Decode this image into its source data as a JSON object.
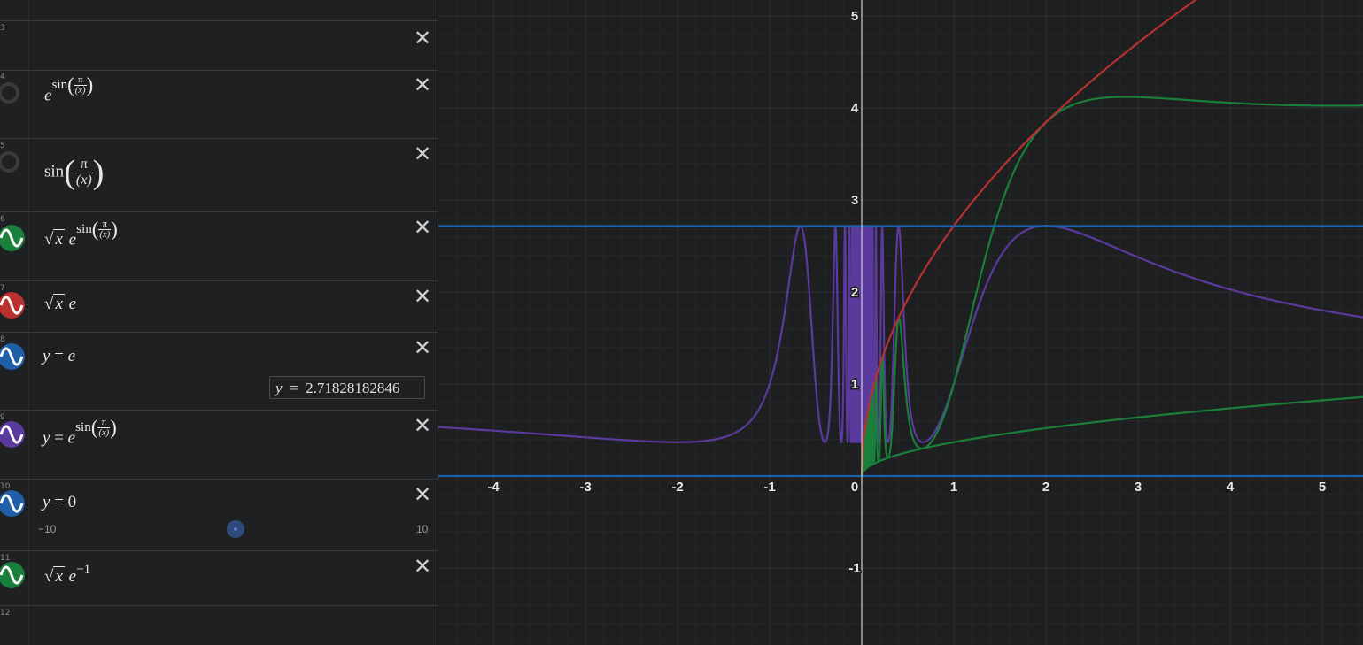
{
  "expressions": [
    {
      "index": "3",
      "type": "empty"
    },
    {
      "index": "4",
      "type": "expr",
      "icon": "ring",
      "latex": "e^sin(π/(x))"
    },
    {
      "index": "5",
      "type": "expr",
      "icon": "ring",
      "latex": "sin(π/(x))"
    },
    {
      "index": "6",
      "type": "expr",
      "icon": "wave",
      "color": "#1a7f3a",
      "latex": "√x e^sin(π/(x))"
    },
    {
      "index": "7",
      "type": "expr",
      "icon": "wave",
      "color": "#b8312e",
      "latex": "√x e"
    },
    {
      "index": "8",
      "type": "expr",
      "icon": "wave",
      "color": "#1f5fa8",
      "latex": "y = e",
      "evaluation": {
        "lhs": "y",
        "eq": "=",
        "value": "2.71828182846"
      }
    },
    {
      "index": "9",
      "type": "expr",
      "icon": "wave",
      "color": "#5b3a9e",
      "latex": "y = e^sin(π/(x))"
    },
    {
      "index": "10",
      "type": "expr",
      "icon": "wave",
      "color": "#1f5fa8",
      "latex": "y = 0",
      "slider": {
        "min": "−10",
        "max": "10"
      }
    },
    {
      "index": "11",
      "type": "expr",
      "icon": "wave",
      "color": "#1a7f3a",
      "latex": "√x e^−1"
    },
    {
      "index": "12",
      "type": "empty"
    }
  ],
  "math": {
    "e": "e",
    "sin": "sin",
    "pi": "π",
    "x_paren": "(x)",
    "x": "x",
    "y": "y",
    "eq": "=",
    "zero": "0",
    "minus_one": "−1",
    "lparen": "(",
    "rparen": ")"
  },
  "graph": {
    "x_ticks": [
      "-4",
      "-3",
      "-2",
      "-1",
      "0",
      "1",
      "2",
      "3",
      "4",
      "5"
    ],
    "y_ticks": [
      "5",
      "4",
      "3",
      "2",
      "1",
      "-1"
    ],
    "xlim": [
      -4.5,
      5.5
    ],
    "ylim": [
      -1.8,
      5.2
    ],
    "colors": {
      "green": "#1a7f3a",
      "red": "#b8312e",
      "blue": "#1f5fa8",
      "purple": "#5b3a9e",
      "background": "#1e1f20",
      "grid_minor": "#262728",
      "grid_major": "#303132",
      "axis": "#cfcfcf"
    }
  }
}
